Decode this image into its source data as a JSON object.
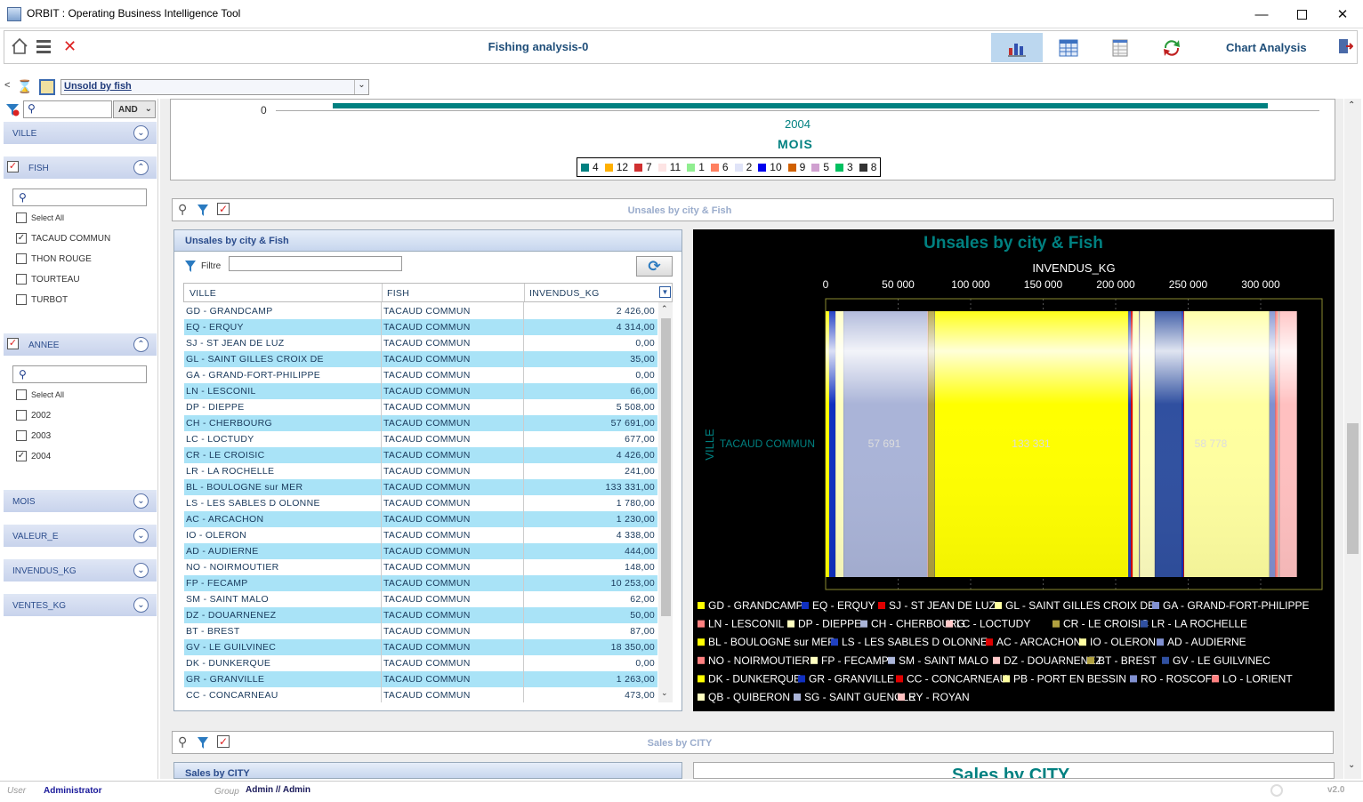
{
  "app": {
    "title": "ORBIT : Operating Business Intelligence Tool"
  },
  "toolbar": {
    "title": "Fishing analysis-0",
    "view_label": "Chart Analysis"
  },
  "selector": {
    "value": "Unsold by fish"
  },
  "sidebar": {
    "operator": "AND",
    "sections": {
      "ville": "VILLE",
      "fish": "FISH",
      "annee": "ANNEE",
      "mois": "MOIS",
      "valeur": "VALEUR_E",
      "invendus": "INVENDUS_KG",
      "ventes": "VENTES_KG"
    },
    "fish_items": [
      {
        "label": "Select All",
        "checked": false
      },
      {
        "label": "TACAUD COMMUN",
        "checked": true
      },
      {
        "label": "THON ROUGE",
        "checked": false
      },
      {
        "label": "TOURTEAU",
        "checked": false
      },
      {
        "label": "TURBOT",
        "checked": false
      }
    ],
    "annee_items": [
      {
        "label": "Select All",
        "checked": false
      },
      {
        "label": "2002",
        "checked": false
      },
      {
        "label": "2003",
        "checked": false
      },
      {
        "label": "2004",
        "checked": true
      }
    ]
  },
  "top_chart": {
    "y_tick": "0",
    "x_tick": "2004",
    "x_label": "MOIS",
    "legend": [
      {
        "label": "4",
        "color": "#008080"
      },
      {
        "label": "12",
        "color": "#ffb000"
      },
      {
        "label": "7",
        "color": "#d03030"
      },
      {
        "label": "11",
        "color": "#fde4e4"
      },
      {
        "label": "1",
        "color": "#90ee90"
      },
      {
        "label": "6",
        "color": "#ff8060"
      },
      {
        "label": "2",
        "color": "#e0e4f8"
      },
      {
        "label": "10",
        "color": "#0000ee"
      },
      {
        "label": "9",
        "color": "#d06000"
      },
      {
        "label": "5",
        "color": "#d0a0d0"
      },
      {
        "label": "3",
        "color": "#00c060"
      },
      {
        "label": "8",
        "color": "#333333"
      }
    ]
  },
  "section1": {
    "title": "Unsales by city & Fish",
    "grid_title": "Unsales by city & Fish",
    "filter_label": "Filtre",
    "columns": [
      "VILLE",
      "FISH",
      "INVENDUS_KG"
    ],
    "rows": [
      [
        "GD - GRANDCAMP",
        "TACAUD COMMUN",
        "2 426,00"
      ],
      [
        "EQ - ERQUY",
        "TACAUD COMMUN",
        "4 314,00"
      ],
      [
        "SJ - ST JEAN DE LUZ",
        "TACAUD COMMUN",
        "0,00"
      ],
      [
        "GL - SAINT GILLES CROIX DE",
        "TACAUD COMMUN",
        "35,00"
      ],
      [
        "GA - GRAND-FORT-PHILIPPE",
        "TACAUD COMMUN",
        "0,00"
      ],
      [
        "LN - LESCONIL",
        "TACAUD COMMUN",
        "66,00"
      ],
      [
        "DP - DIEPPE",
        "TACAUD COMMUN",
        "5 508,00"
      ],
      [
        "CH - CHERBOURG",
        "TACAUD COMMUN",
        "57 691,00"
      ],
      [
        "LC - LOCTUDY",
        "TACAUD COMMUN",
        "677,00"
      ],
      [
        "CR - LE CROISIC",
        "TACAUD COMMUN",
        "4 426,00"
      ],
      [
        "LR - LA ROCHELLE",
        "TACAUD COMMUN",
        "241,00"
      ],
      [
        "BL - BOULOGNE sur MER",
        "TACAUD COMMUN",
        "133 331,00"
      ],
      [
        "LS - LES SABLES D OLONNE",
        "TACAUD COMMUN",
        "1 780,00"
      ],
      [
        "AC - ARCACHON",
        "TACAUD COMMUN",
        "1 230,00"
      ],
      [
        "IO - OLERON",
        "TACAUD COMMUN",
        "4 338,00"
      ],
      [
        "AD - AUDIERNE",
        "TACAUD COMMUN",
        "444,00"
      ],
      [
        "NO - NOIRMOUTIER",
        "TACAUD COMMUN",
        "148,00"
      ],
      [
        "FP - FECAMP",
        "TACAUD COMMUN",
        "10 253,00"
      ],
      [
        "SM - SAINT MALO",
        "TACAUD COMMUN",
        "62,00"
      ],
      [
        "DZ - DOUARNENEZ",
        "TACAUD COMMUN",
        "50,00"
      ],
      [
        "BT - BREST",
        "TACAUD COMMUN",
        "87,00"
      ],
      [
        "GV - LE GUILVINEC",
        "TACAUD COMMUN",
        "18 350,00"
      ],
      [
        "DK - DUNKERQUE",
        "TACAUD COMMUN",
        "0,00"
      ],
      [
        "GR - GRANVILLE",
        "TACAUD COMMUN",
        "1 263,00"
      ],
      [
        "CC - CONCARNEAU",
        "TACAUD COMMUN",
        "473,00"
      ]
    ]
  },
  "chart_data": {
    "type": "bar",
    "title": "Unsales by city & Fish",
    "xlabel": "INVENDUS_KG",
    "ylabel": "VILLE",
    "categories": [
      "TACAUD COMMUN"
    ],
    "stacked": true,
    "orientation": "horizontal",
    "xlim": [
      0,
      330000
    ],
    "x_ticks": [
      "0",
      "50 000",
      "100 000",
      "150 000",
      "200 000",
      "250 000",
      "300 000"
    ],
    "data_labels": [
      "57 691",
      "133 331",
      "58 778"
    ],
    "legend_position": "bottom",
    "series": [
      {
        "name": "GD - GRANDCAMP",
        "values": [
          2426
        ],
        "color": "#ffff00"
      },
      {
        "name": "EQ - ERQUY",
        "values": [
          4314
        ],
        "color": "#1030c0"
      },
      {
        "name": "SJ - ST JEAN DE LUZ",
        "values": [
          0
        ],
        "color": "#e00000"
      },
      {
        "name": "GL - SAINT GILLES CROIX DE",
        "values": [
          35
        ],
        "color": "#ffffa0"
      },
      {
        "name": "GA - GRAND-FORT-PHILIPPE",
        "values": [
          0
        ],
        "color": "#8090d0"
      },
      {
        "name": "LN - LESCONIL",
        "values": [
          66
        ],
        "color": "#ff8080"
      },
      {
        "name": "DP - DIEPPE",
        "values": [
          5508
        ],
        "color": "#ffffc0"
      },
      {
        "name": "CH - CHERBOURG",
        "values": [
          57691
        ],
        "color": "#aab4d8"
      },
      {
        "name": "LC - LOCTUDY",
        "values": [
          677
        ],
        "color": "#ffc8c8"
      },
      {
        "name": "CR - LE CROISIC",
        "values": [
          4426
        ],
        "color": "#b0a040"
      },
      {
        "name": "LR - LA ROCHELLE",
        "values": [
          241
        ],
        "color": "#3050a0"
      },
      {
        "name": "BL - BOULOGNE sur MER",
        "values": [
          133331
        ],
        "color": "#ffff00"
      },
      {
        "name": "LS - LES SABLES D OLONNE",
        "values": [
          1780
        ],
        "color": "#2040c0"
      },
      {
        "name": "AC - ARCACHON",
        "values": [
          1230
        ],
        "color": "#e00000"
      },
      {
        "name": "IO - OLERON",
        "values": [
          4338
        ],
        "color": "#ffffa0"
      },
      {
        "name": "AD - AUDIERNE",
        "values": [
          444
        ],
        "color": "#8090d0"
      },
      {
        "name": "NO - NOIRMOUTIER",
        "values": [
          148
        ],
        "color": "#ff8080"
      },
      {
        "name": "FP - FECAMP",
        "values": [
          10253
        ],
        "color": "#ffffc0"
      },
      {
        "name": "SM - SAINT MALO",
        "values": [
          62
        ],
        "color": "#aab4d8"
      },
      {
        "name": "DZ - DOUARNENEZ",
        "values": [
          50
        ],
        "color": "#ffc8c8"
      },
      {
        "name": "BT - BREST",
        "values": [
          87
        ],
        "color": "#b0a040"
      },
      {
        "name": "GV - LE GUILVINEC",
        "values": [
          18350
        ],
        "color": "#3050a0"
      },
      {
        "name": "DK - DUNKERQUE",
        "values": [
          0
        ],
        "color": "#ffff00"
      },
      {
        "name": "GR - GRANVILLE",
        "values": [
          1263
        ],
        "color": "#1030c0"
      },
      {
        "name": "CC - CONCARNEAU",
        "values": [
          473
        ],
        "color": "#e00000"
      },
      {
        "name": "PB - PORT EN BESSIN",
        "values": [
          58778
        ],
        "color": "#ffffa0"
      },
      {
        "name": "RO - ROSCOFF",
        "values": [
          4000
        ],
        "color": "#8090d0"
      },
      {
        "name": "LO - LORIENT",
        "values": [
          2000
        ],
        "color": "#ff8080"
      },
      {
        "name": "QB - QUIBERON",
        "values": [
          500
        ],
        "color": "#ffffc0"
      },
      {
        "name": "SG - SAINT GUENOLE",
        "values": [
          500
        ],
        "color": "#aab4d8"
      },
      {
        "name": "RY - ROYAN",
        "values": [
          12000
        ],
        "color": "#ffc0c0"
      }
    ]
  },
  "section2": {
    "title": "Sales by CITY",
    "grid_title": "Sales by CITY",
    "chart_title": "Sales by CITY"
  },
  "status": {
    "user_label": "User",
    "user": "Administrator",
    "group_label": "Group",
    "group": "Admin // Admin",
    "version": "v2.0"
  }
}
